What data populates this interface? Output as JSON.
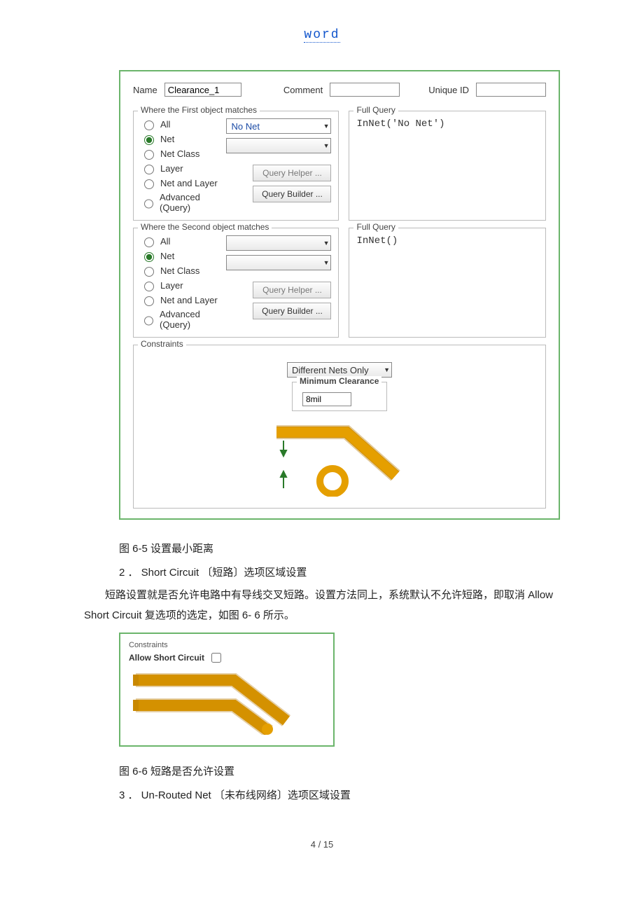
{
  "header_link": "word",
  "fig1": {
    "name_label": "Name",
    "name_value": "Clearance_1",
    "comment_label": "Comment",
    "comment_value": "",
    "unique_label": "Unique ID",
    "unique_value": "",
    "groups": {
      "first_legend": "Where the First object matches",
      "second_legend": "Where the Second object matches",
      "full_query_legend": "Full Query",
      "radios": {
        "all": "All",
        "net": "Net",
        "net_class": "Net Class",
        "layer": "Layer",
        "net_and_layer": "Net and Layer",
        "advanced": "Advanced (Query)"
      },
      "combo1_first": "No Net",
      "combo2_first": "",
      "query_helper": "Query Helper ...",
      "query_builder": "Query Builder ...",
      "full_query_1": "InNet('No Net')",
      "full_query_2": "InNet()"
    },
    "constraints_legend": "Constraints",
    "diff_nets": "Different Nets Only",
    "clearance_label": "Minimum Clearance",
    "clearance_value": "8mil"
  },
  "captions": {
    "fig65": "图 6-5  设置最小距离",
    "item2": "2 ． Short Circuit 〔短路〕选项区域设置",
    "para1": "短路设置就是否允许电路中有导线交叉短路。设置方法同上，系统默认不允许短路，即取消 Allow Short Circuit 复选项的选定，如图 6- 6 所示。",
    "fig66": "图 6-6  短路是否允许设置",
    "item3": "3 ． Un-Routed Net 〔未布线网络〕选项区域设置"
  },
  "fig2": {
    "constraints_legend": "Constraints",
    "allow_label": "Allow Short Circuit"
  },
  "footer": "4  / 15"
}
